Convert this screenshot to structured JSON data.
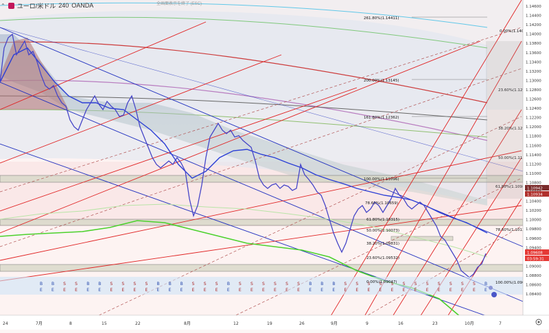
{
  "header": {
    "symbol": "ユーロ/米ドル",
    "timeframe": "240",
    "broker": "OANDA",
    "watermark": "全画面表示を終了 (ESC)"
  },
  "colors": {
    "accent": "#c2185b",
    "ma_blue": "#2b3fd6",
    "ma_green": "#4bd12c",
    "channel_blue": "#1f2fbf",
    "fan_red": "#e02020",
    "current_price_bg": "#e53935",
    "bull_candle": "#3b3bd9",
    "bear_candle": "#6b4d97"
  },
  "price_axis": {
    "labels": [
      "1.14600",
      "1.14400",
      "1.14200",
      "1.14000",
      "1.13800",
      "1.13600",
      "1.13400",
      "1.13200",
      "1.13000",
      "1.12800",
      "1.12600",
      "1.12400",
      "1.12200",
      "1.12000",
      "1.11800",
      "1.11600",
      "1.11400",
      "1.11200",
      "1.11000",
      "1.10800",
      "1.10600",
      "1.10400",
      "1.10200",
      "1.10000",
      "1.09800",
      "1.09600",
      "1.09400",
      "1.09200",
      "1.09000",
      "1.08800",
      "1.08600",
      "1.08400"
    ],
    "tag_1": "1.10942",
    "tag_2": "1.10934",
    "current_price": "1.09608",
    "countdown": "03:59:31"
  },
  "time_axis": {
    "labels": [
      "24",
      "7月",
      "8",
      "15",
      "22",
      "8月",
      "12",
      "19",
      "26",
      "9月",
      "9",
      "16",
      "23",
      "10月",
      "7"
    ]
  },
  "fib_upper": {
    "levels": [
      "261.80%(1.14411)",
      "200.00%(1.13145)",
      "161.80%(1.12362)",
      "100.00%(1.11096)",
      "78.60%(1.10659)",
      "61.80%(1.10315)",
      "50.00%(1.10073)",
      "38.20%(1.09831)",
      "23.60%(1.09532)",
      "0.00%(1.09047)"
    ]
  },
  "fib_right": {
    "levels": [
      "0.00%(1.14022)",
      "23.60%(1.12924)",
      "38.20%(1.12183)",
      "50.00%(1.11585)",
      "61.80%(1.10986)",
      "78.60%(1.10133)",
      "100.00%(1.09047)"
    ]
  },
  "markers": {
    "labels": [
      "BE",
      "BE",
      "SE",
      "SE",
      "BE",
      "BE",
      "SE",
      "SE",
      "SE",
      "SE",
      "BE",
      "BE",
      "BE",
      "SE",
      "SE",
      "SE",
      "BE",
      "SE",
      "SE",
      "SE",
      "SE",
      "SE",
      "SE",
      "BE",
      "BE",
      "BE",
      "SE",
      "SE",
      "SE",
      "SE",
      "SE",
      "SE",
      "SE",
      "SE",
      "SE",
      "SE",
      "SE",
      "SE",
      "BE"
    ]
  }
}
